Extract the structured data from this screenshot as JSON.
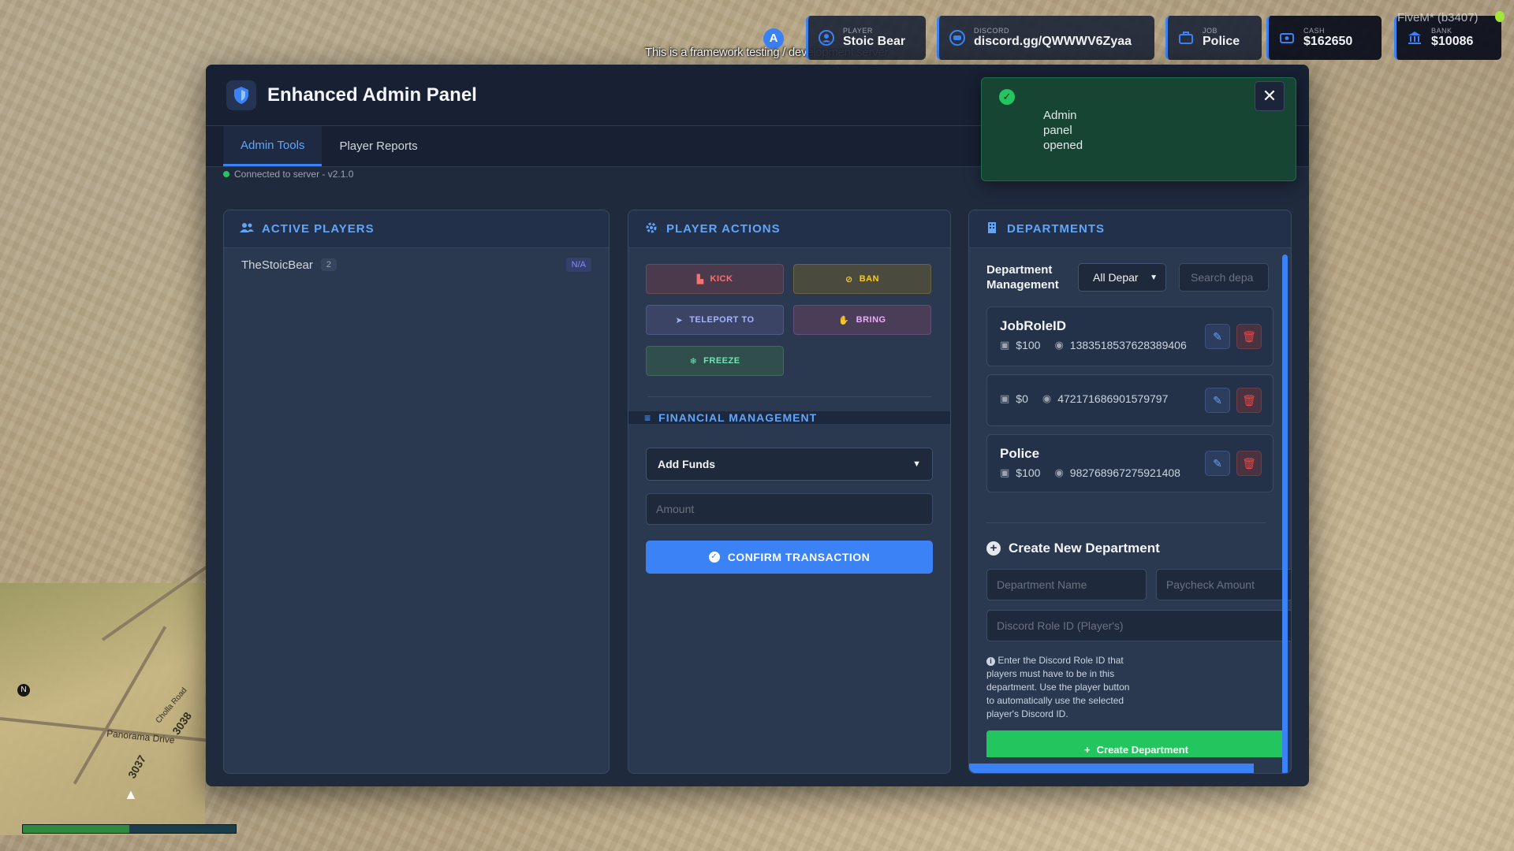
{
  "hud": {
    "notification_text": "This is a framework testing / development server.",
    "server_tag": "FiveM* (b3407)",
    "player": {
      "label": "PLAYER",
      "value": "Stoic Bear"
    },
    "discord": {
      "label": "DISCORD",
      "value": "discord.gg/QWWWV6Zyaa"
    },
    "job": {
      "label": "JOB",
      "value": "Police"
    },
    "cash": {
      "label": "CASH",
      "value": "$162650"
    },
    "bank": {
      "label": "BANK",
      "value": "$10086"
    },
    "marker_letter": "A"
  },
  "minimap": {
    "north": "N",
    "street_1": "Panorama Drive",
    "street_2": "Cholla Road",
    "num_1": "3038",
    "num_2": "3037",
    "health_fraction": 0.5
  },
  "panel": {
    "title": "Enhanced Admin Panel",
    "tabs": [
      {
        "label": "Admin Tools",
        "active": true
      },
      {
        "label": "Player Reports",
        "active": false
      }
    ],
    "status": "Connected to server - v2.1.0"
  },
  "active_players": {
    "title": "ACTIVE PLAYERS",
    "players": [
      {
        "name": "TheStoicBear",
        "id": "2",
        "tag": "N/A"
      }
    ]
  },
  "player_actions": {
    "title": "PLAYER ACTIONS",
    "buttons": {
      "kick": "KICK",
      "ban": "BAN",
      "teleport": "TELEPORT TO",
      "bring": "BRING",
      "freeze": "FREEZE"
    },
    "financial": {
      "title": "FINANCIAL MANAGEMENT",
      "selected_option": "Add Funds",
      "amount_placeholder": "Amount",
      "confirm_label": "CONFIRM TRANSACTION"
    }
  },
  "departments": {
    "title": "DEPARTMENTS",
    "management_label": "Department Management",
    "filter_value": "All Depar",
    "search_placeholder": "Search depa",
    "items": [
      {
        "name": "JobRoleID",
        "paycheck": "$100",
        "role_id": "1383518537628389406"
      },
      {
        "name": "",
        "paycheck": "$0",
        "role_id": "472171686901579797"
      },
      {
        "name": "Police",
        "paycheck": "$100",
        "role_id": "982768967275921408"
      }
    ],
    "create": {
      "title": "Create New Department",
      "name_placeholder": "Department Name",
      "paycheck_placeholder": "Paycheck Amount",
      "role_placeholder": "Discord Role ID (Player's)",
      "note": "Enter the Discord Role ID that players must have to be in this department. Use the player button to automatically use the selected player's Discord ID.",
      "button_label": "Create Department"
    }
  },
  "toast": {
    "message": "Admin panel opened"
  },
  "colors": {
    "accent": "#3b82f6",
    "success": "#22c55e",
    "danger": "#ef4444",
    "panel_bg": "#1f2a3d"
  }
}
